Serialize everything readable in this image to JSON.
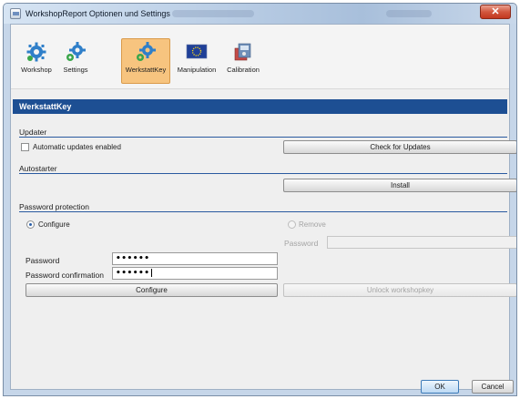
{
  "window": {
    "title": "WorkshopReport Optionen und Settings",
    "close_symbol": "✕"
  },
  "toolbar": {
    "items": [
      {
        "label": "Workshop",
        "icon": "gear-blue-icon"
      },
      {
        "label": "Settings",
        "icon": "gears-icon"
      },
      {
        "label": "WerkstattKey",
        "icon": "gears-key-icon",
        "selected": true
      },
      {
        "label": "Manipulation",
        "icon": "eu-flag-icon"
      },
      {
        "label": "Calibration",
        "icon": "calibration-box-icon"
      }
    ]
  },
  "panel": {
    "title": "WerkstattKey"
  },
  "updater": {
    "heading": "Updater",
    "auto_label": "Automatic updates enabled",
    "auto_checked": false,
    "check_button": "Check for Updates"
  },
  "autostarter": {
    "heading": "Autostarter",
    "install_button": "Install"
  },
  "password_protection": {
    "heading": "Password protection",
    "configure_option": "Configure",
    "remove_option": "Remove",
    "remove_password_label": "Password",
    "password_label": "Password",
    "password_value": "••••••",
    "confirm_label": "Password confirmation",
    "confirm_value": "••••••",
    "configure_button": "Configure",
    "unlock_button": "Unlock workshopkey"
  },
  "footer": {
    "ok": "OK",
    "cancel": "Cancel"
  },
  "colors": {
    "accent": "#1d4f93",
    "selected_tab": "#f7c47f",
    "close": "#c2381f"
  }
}
